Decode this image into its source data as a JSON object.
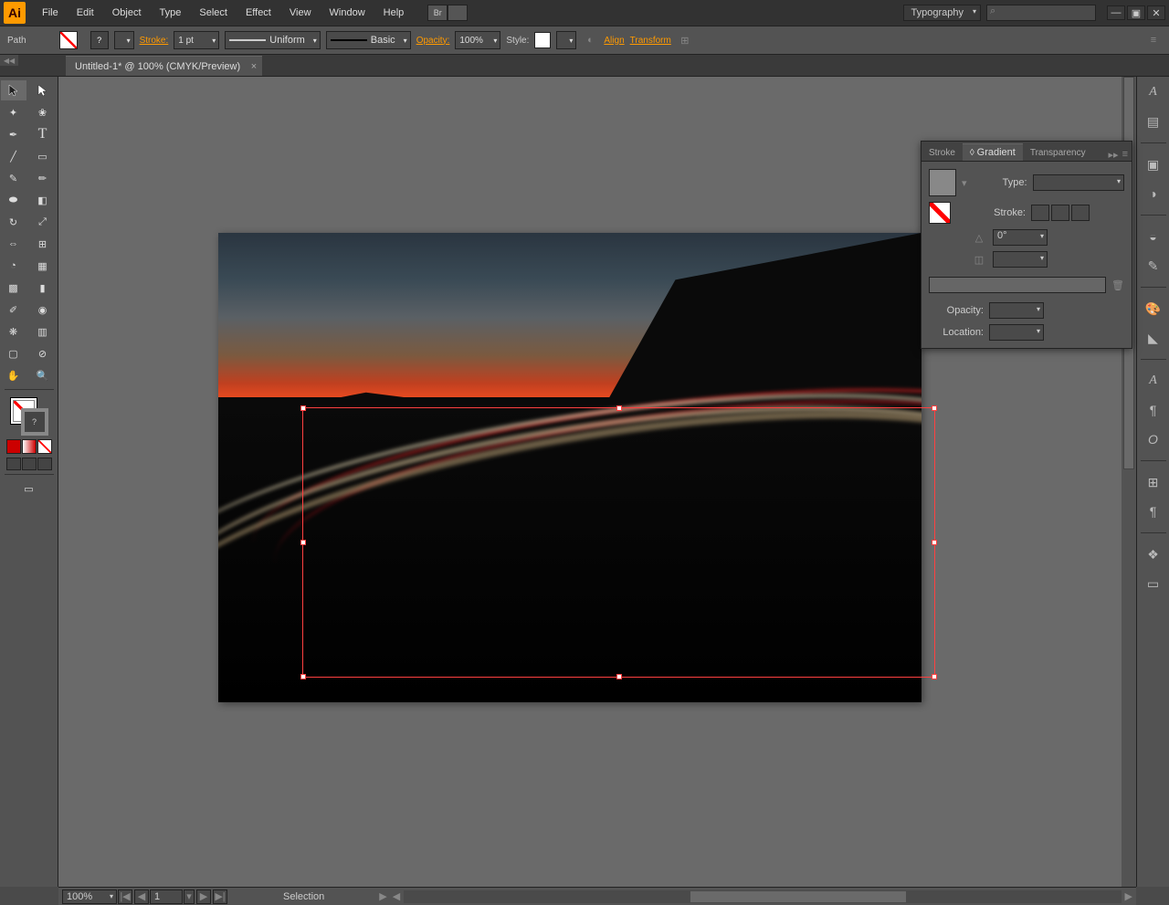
{
  "app": {
    "name": "Ai"
  },
  "menu": [
    "File",
    "Edit",
    "Object",
    "Type",
    "Select",
    "Effect",
    "View",
    "Window",
    "Help"
  ],
  "header": {
    "bridge": "Br",
    "workspace": "Typography"
  },
  "controlbar": {
    "selection_label": "Path",
    "stroke_label": "Stroke:",
    "stroke_value": "1 pt",
    "brush_profile": "Uniform",
    "brush_def": "Basic",
    "opacity_label": "Opacity:",
    "opacity_value": "100%",
    "style_label": "Style:",
    "align_link": "Align",
    "transform_link": "Transform"
  },
  "document": {
    "tab_title": "Untitled-1* @ 100% (CMYK/Preview)"
  },
  "gradient_panel": {
    "tabs": [
      "Stroke",
      "Gradient",
      "Transparency"
    ],
    "active_tab": 1,
    "type_label": "Type:",
    "stroke_label": "Stroke:",
    "angle_value": "0°",
    "opacity_label": "Opacity:",
    "location_label": "Location:"
  },
  "statusbar": {
    "zoom": "100%",
    "artboard": "1",
    "mode": "Selection"
  },
  "tools_left": [
    "selection",
    "direct-selection",
    "magic-wand",
    "lasso",
    "pen",
    "type",
    "line",
    "rectangle",
    "paintbrush",
    "pencil",
    "blob-brush",
    "eraser",
    "rotate",
    "scale",
    "width",
    "free-transform",
    "shape-builder",
    "perspective",
    "mesh",
    "gradient",
    "eyedropper",
    "blend",
    "symbol-sprayer",
    "column-graph",
    "artboard",
    "slice",
    "hand",
    "zoom"
  ],
  "dock_right": [
    "character",
    "paragraph",
    "opentype",
    "color",
    "color-guide",
    "swatches",
    "brushes",
    "symbols",
    "stroke",
    "gradient",
    "transparency",
    "appearance",
    "graphic-styles",
    "layers",
    "artboards",
    "transform"
  ]
}
